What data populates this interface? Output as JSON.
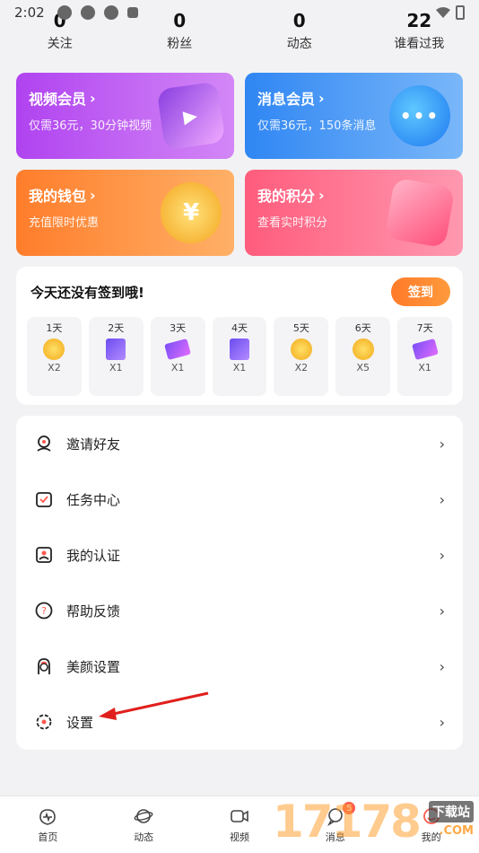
{
  "status": {
    "time": "2:02"
  },
  "stats": [
    {
      "num": "0",
      "label": "关注"
    },
    {
      "num": "0",
      "label": "粉丝"
    },
    {
      "num": "0",
      "label": "动态"
    },
    {
      "num": "22",
      "label": "谁看过我"
    }
  ],
  "cards": [
    {
      "title": "视频会员",
      "sub": "仅需36元，30分钟视频"
    },
    {
      "title": "消息会员",
      "sub": "仅需36元，150条消息"
    },
    {
      "title": "我的钱包",
      "sub": "充值限时优惠"
    },
    {
      "title": "我的积分",
      "sub": "查看实时积分"
    }
  ],
  "signin": {
    "prompt": "今天还没有签到哦!",
    "button": "签到",
    "days": [
      {
        "day": "1天",
        "reward": "X2",
        "icon": "coin-icon"
      },
      {
        "day": "2天",
        "reward": "X1",
        "icon": "vip-card-icon"
      },
      {
        "day": "3天",
        "reward": "X1",
        "icon": "ticket-icon"
      },
      {
        "day": "4天",
        "reward": "X1",
        "icon": "vip-card-icon"
      },
      {
        "day": "5天",
        "reward": "X2",
        "icon": "coin-icon"
      },
      {
        "day": "6天",
        "reward": "X5",
        "icon": "coin-icon"
      },
      {
        "day": "7天",
        "reward": "X1",
        "icon": "ticket-icon"
      }
    ]
  },
  "menu": [
    {
      "label": "邀请好友",
      "icon": "invite-icon"
    },
    {
      "label": "任务中心",
      "icon": "task-icon"
    },
    {
      "label": "我的认证",
      "icon": "verify-icon"
    },
    {
      "label": "帮助反馈",
      "icon": "help-icon"
    },
    {
      "label": "美颜设置",
      "icon": "beauty-icon"
    },
    {
      "label": "设置",
      "icon": "settings-icon"
    }
  ],
  "tabs": [
    {
      "label": "首页",
      "icon": "home-icon"
    },
    {
      "label": "动态",
      "icon": "planet-icon"
    },
    {
      "label": "视频",
      "icon": "video-icon"
    },
    {
      "label": "消息",
      "icon": "message-icon",
      "badge": "5"
    },
    {
      "label": "我的",
      "icon": "profile-icon"
    }
  ],
  "watermark": {
    "num": "17178",
    "text": "下载站",
    "com": ".COM"
  }
}
